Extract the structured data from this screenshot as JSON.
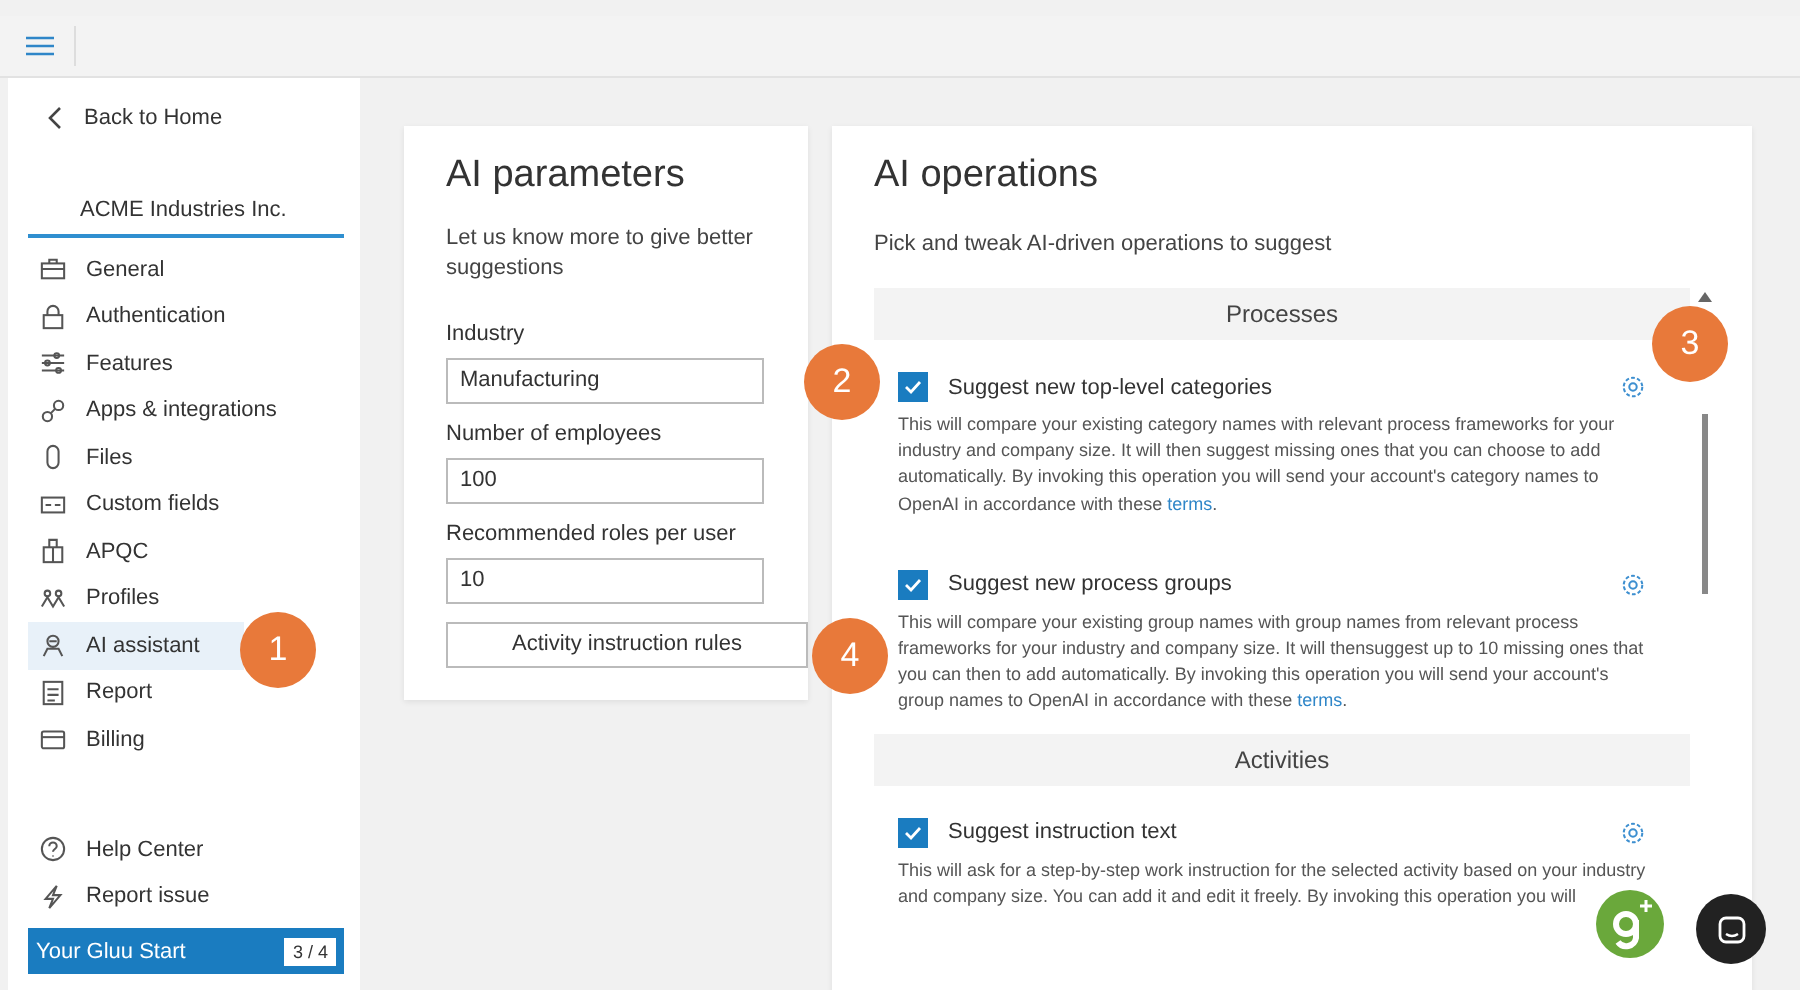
{
  "sidebar": {
    "back": "Back to Home",
    "company": "ACME Industries Inc.",
    "items": [
      {
        "label": "General",
        "selected": false
      },
      {
        "label": "Authentication",
        "selected": false
      },
      {
        "label": "Features",
        "selected": false
      },
      {
        "label": "Apps & integrations",
        "selected": false
      },
      {
        "label": "Files",
        "selected": false
      },
      {
        "label": "Custom fields",
        "selected": false
      },
      {
        "label": "APQC",
        "selected": false
      },
      {
        "label": "Profiles",
        "selected": false
      },
      {
        "label": "AI assistant",
        "selected": true
      },
      {
        "label": "Report",
        "selected": false
      },
      {
        "label": "Billing",
        "selected": false
      }
    ],
    "footer": [
      "Help Center",
      "Report issue"
    ],
    "start": {
      "label": "Your Gluu Start",
      "count": "3 / 4"
    }
  },
  "parameters": {
    "title": "AI parameters",
    "intro": "Let us know more to give better suggestions",
    "fields": [
      {
        "label": "Industry",
        "value": "Manufacturing"
      },
      {
        "label": "Number of employees",
        "value": "100"
      },
      {
        "label": "Recommended roles per user",
        "value": "10"
      }
    ],
    "button": "Activity instruction rules"
  },
  "operations": {
    "title": "AI operations",
    "intro": "Pick and tweak AI-driven operations to suggest",
    "sections": [
      {
        "title": "Processes",
        "items": [
          {
            "title": "Suggest new top-level categories",
            "checked": true,
            "text": "This will compare your existing category names with relevant process frameworks for your industry and company size. It will then suggest missing ones that you can choose to add automatically. By invoking this operation you will send your account's category names to OpenAI in accordance with these ",
            "link": "terms",
            "end": "."
          },
          {
            "title": "Suggest new process groups",
            "checked": true,
            "text": "This will compare your existing group names with group names from relevant process frameworks for your industry and company size. It will thensuggest up to 10 missing ones that you can then to add automatically. By invoking this operation you will send your account's group names to OpenAI in accordance with these ",
            "link": "terms",
            "end": "."
          }
        ]
      },
      {
        "title": "Activities",
        "items": [
          {
            "title": "Suggest instruction text",
            "checked": true,
            "text": "This will ask for a step-by-step work instruction for the selected activity based on your industry and company size. You can add it and edit it freely. By invoking this operation you will"
          }
        ]
      }
    ]
  },
  "step_markers": [
    "1",
    "2",
    "3",
    "4"
  ]
}
